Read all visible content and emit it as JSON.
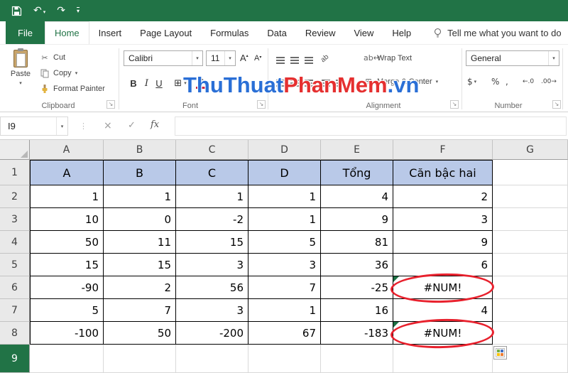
{
  "theme": {
    "excel_green": "#217346",
    "annotation_red": "#e8212d",
    "header_fill": "#b9c9e8",
    "error_indicator": "#1d7044"
  },
  "icons": {
    "dropdown": "▾",
    "up_arrow": "▴",
    "undo": "↶",
    "redo": "↷",
    "cut": "✂",
    "merge": "⊞",
    "borders": "⊞",
    "wrap": "ab↩",
    "orientation": "ab",
    "cancel": "×",
    "enter": "✓",
    "fx": "fx",
    "dialog_launcher": "↘",
    "dots": "⋮",
    "grow_font": "A",
    "shrink_font": "A"
  },
  "tabs": {
    "file": "File",
    "items": [
      "Home",
      "Insert",
      "Page Layout",
      "Formulas",
      "Data",
      "Review",
      "View",
      "Help"
    ],
    "tell_me": "Tell me what you want to do"
  },
  "ribbon": {
    "clipboard": {
      "label": "Clipboard",
      "paste": "Paste",
      "cut": "Cut",
      "copy": "Copy",
      "format_painter": "Format Painter"
    },
    "font": {
      "label": "Font",
      "font_name": "Calibri",
      "font_size": "11",
      "bold": "B",
      "italic": "I",
      "underline": "U"
    },
    "alignment": {
      "label": "Alignment",
      "wrap_text": "Wrap Text",
      "merge_center": "Merge & Center"
    },
    "number": {
      "label": "Number",
      "format": "General",
      "currency": "$",
      "percent": "%",
      "comma": ",",
      "increase_decimal": "←.0",
      "decrease_decimal": ".00→"
    }
  },
  "watermark": {
    "part1": "ThuThuat",
    "part2": "PhanMem",
    "part3": ".vn",
    "blue": "#2a6fd6",
    "red": "#e53030"
  },
  "formula_bar": {
    "name_box": "I9",
    "formula": ""
  },
  "sheet": {
    "columns": [
      "A",
      "B",
      "C",
      "D",
      "E",
      "F",
      "G"
    ],
    "rows": [
      "1",
      "2",
      "3",
      "4",
      "5",
      "6",
      "7",
      "8",
      "9"
    ],
    "selected_row_header": "9",
    "error_value": "#NUM!",
    "header_row": {
      "values": [
        "A",
        "B",
        "C",
        "D",
        "Tổng",
        "Căn bậc hai"
      ]
    },
    "data_rows": [
      [
        "1",
        "1",
        "1",
        "1",
        "4",
        "2"
      ],
      [
        "10",
        "0",
        "-2",
        "1",
        "9",
        "3"
      ],
      [
        "50",
        "11",
        "15",
        "5",
        "81",
        "9"
      ],
      [
        "15",
        "15",
        "3",
        "3",
        "36",
        "6"
      ],
      [
        "-90",
        "2",
        "56",
        "7",
        "-25",
        "#NUM!"
      ],
      [
        "5",
        "7",
        "3",
        "1",
        "16",
        "4"
      ],
      [
        "-100",
        "50",
        "-200",
        "67",
        "-183",
        "#NUM!"
      ]
    ]
  }
}
